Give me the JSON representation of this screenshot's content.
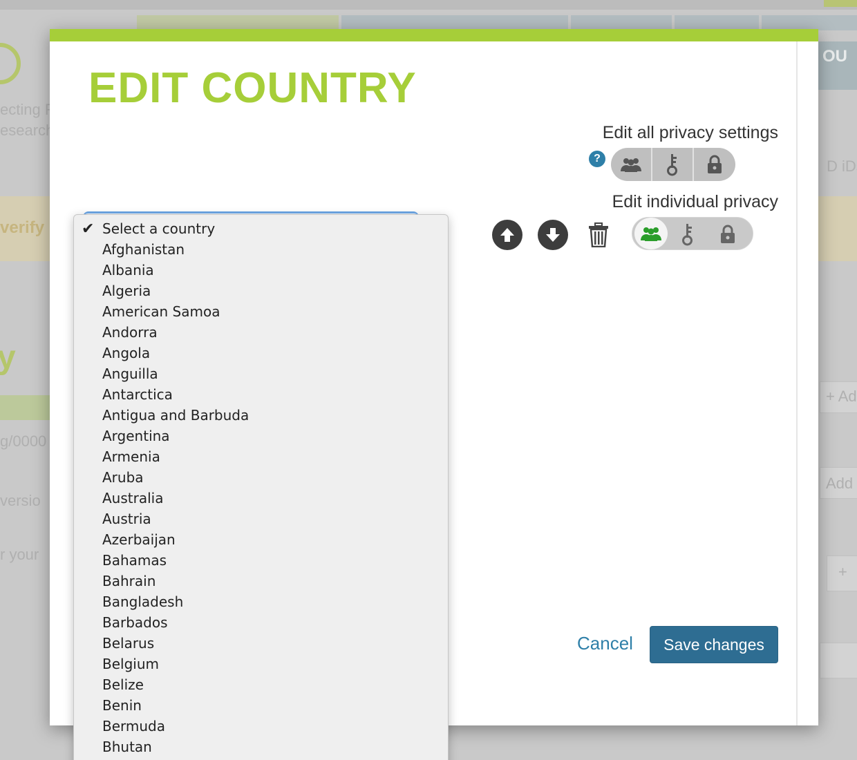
{
  "background": {
    "ghost_texts": [
      "ecting R",
      "esearch",
      "verify",
      "y",
      "g/0000",
      "versio",
      "r your",
      "D iDs a",
      "+ Ad",
      "Add",
      "+",
      "OU"
    ]
  },
  "modal": {
    "title": "EDIT COUNTRY",
    "accent_color": "#a6ce39",
    "privacy_all": {
      "label": "Edit all privacy settings",
      "help_icon": "?",
      "options": [
        "everyone-icon",
        "trusted-parties-icon",
        "only-me-icon"
      ]
    },
    "privacy_individual": {
      "label": "Edit individual privacy",
      "options": [
        "everyone-icon",
        "trusted-parties-icon",
        "only-me-icon"
      ],
      "selected": "everyone-icon"
    },
    "actions": {
      "cancel": "Cancel",
      "save": "Save changes"
    },
    "country_select": {
      "selected": "Select a country",
      "options": [
        "Select a country",
        "Afghanistan",
        "Albania",
        "Algeria",
        "American Samoa",
        "Andorra",
        "Angola",
        "Anguilla",
        "Antarctica",
        "Antigua and Barbuda",
        "Argentina",
        "Armenia",
        "Aruba",
        "Australia",
        "Austria",
        "Azerbaijan",
        "Bahamas",
        "Bahrain",
        "Bangladesh",
        "Barbados",
        "Belarus",
        "Belgium",
        "Belize",
        "Benin",
        "Bermuda",
        "Bhutan"
      ]
    }
  }
}
